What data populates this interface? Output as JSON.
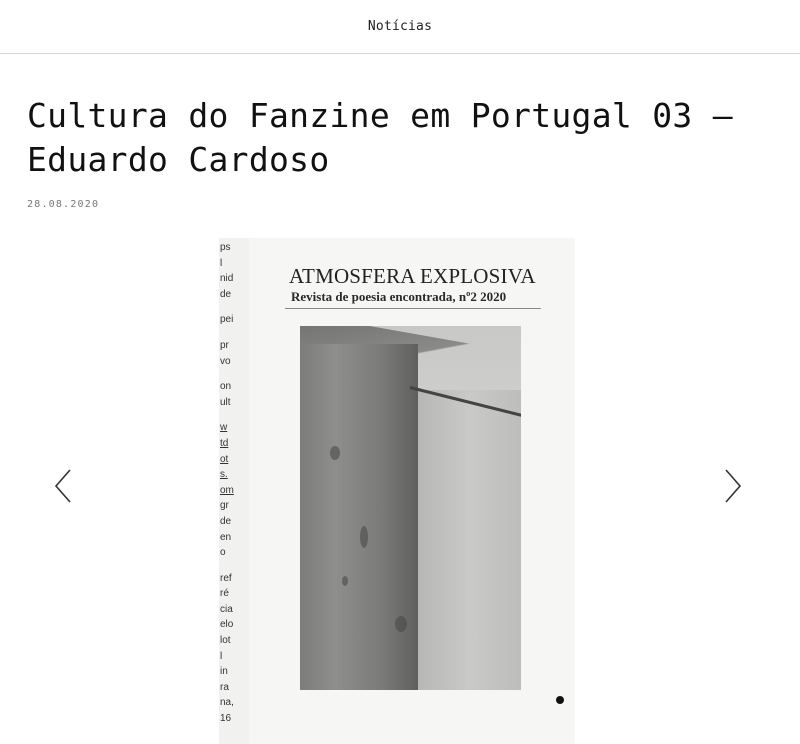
{
  "header": {
    "nav_label": "Notícias"
  },
  "article": {
    "title": "Cultura do Fanzine em Portugal 03 – Eduardo Cardoso",
    "date": "28.08.2020"
  },
  "carousel": {
    "prev_icon": "chevron-left-icon",
    "next_icon": "chevron-right-icon",
    "slide_count": 5,
    "active_index": 0,
    "slide": {
      "magazine_title": "ATMOSFERA EXPLOSIVA",
      "magazine_subtitle": "Revista de poesia encontrada, nº2 2020",
      "side_text": [
        "ps",
        "l",
        "nid",
        "de",
        "",
        "pei",
        "",
        "pr",
        "vo",
        "",
        "on",
        "ult",
        "",
        "w",
        "td",
        "ot",
        "s.",
        "om",
        "gr",
        "de",
        "en",
        "o",
        "",
        "ref",
        "ré",
        "cia",
        "elo",
        "lot",
        "l",
        "in",
        "ra",
        "na,",
        "16"
      ]
    }
  },
  "colors": {
    "background": "#ffffff",
    "divider": "#d6d6d6",
    "text": "#111111",
    "dot_active": "#111111",
    "dot_inactive": "#e4e4e2"
  }
}
